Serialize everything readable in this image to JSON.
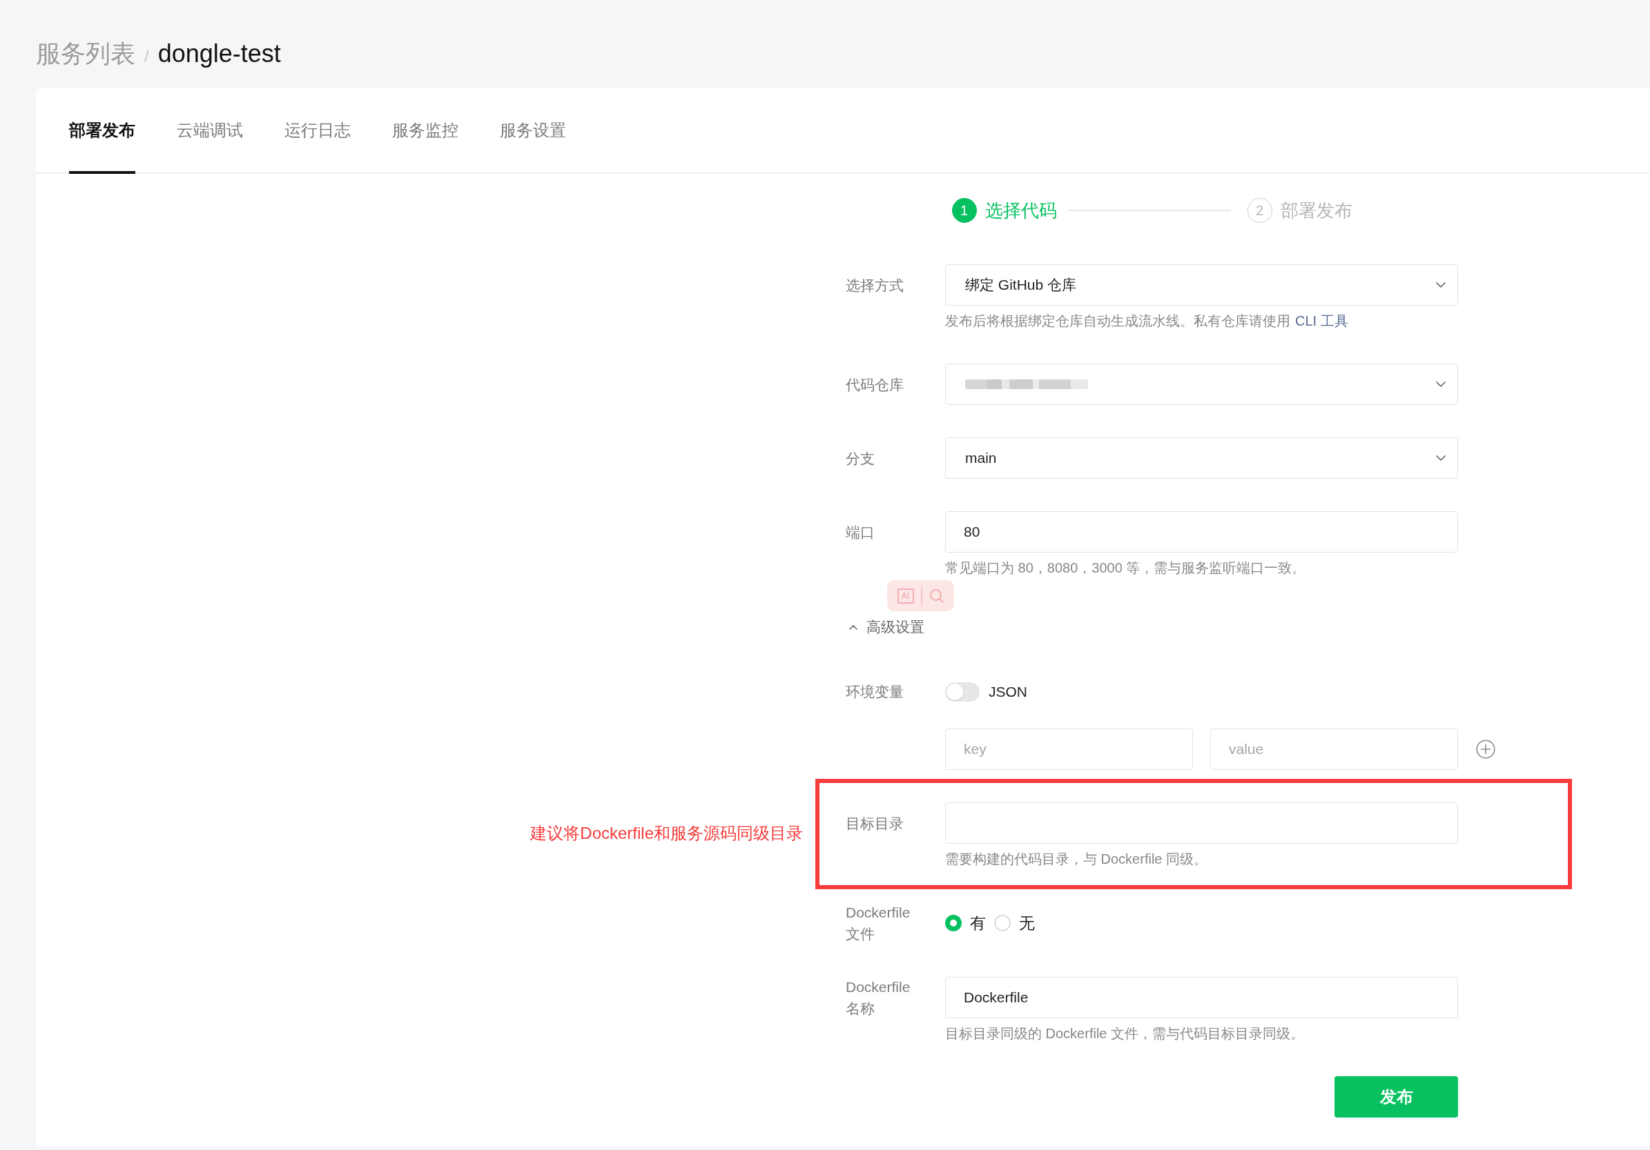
{
  "breadcrumb": {
    "parent": "服务列表",
    "separator": "/",
    "current": "dongle-test"
  },
  "tabs": [
    {
      "label": "部署发布",
      "selected": true
    },
    {
      "label": "云端调试",
      "selected": false
    },
    {
      "label": "运行日志",
      "selected": false
    },
    {
      "label": "服务监控",
      "selected": false
    },
    {
      "label": "服务设置",
      "selected": false
    }
  ],
  "steps": [
    {
      "number": "1",
      "label": "选择代码",
      "current": true
    },
    {
      "number": "2",
      "label": "部署发布",
      "current": false
    }
  ],
  "form": {
    "rows": [
      {
        "kind": "select",
        "label": "选择方式",
        "value": "绑定 GitHub 仓库",
        "help": "发布后将根据绑定仓库自动生成流水线。私有仓库请使用",
        "help_link": "CLI 工具"
      },
      {
        "kind": "select",
        "label": "代码仓库",
        "blurred": true
      },
      {
        "kind": "select",
        "label": "分支",
        "value": "main"
      },
      {
        "kind": "input",
        "label": "端口",
        "value": "80",
        "help": "常见端口为 80，8080，3000 等，需与服务监听端口一致。"
      },
      {
        "kind": "collapse",
        "label": "高级设置",
        "expanded": true
      },
      {
        "kind": "switch",
        "label": "环境变量",
        "switch_label": "JSON",
        "on": false
      },
      {
        "kind": "keyvalue",
        "key_placeholder": "key",
        "value_placeholder": "value"
      },
      {
        "kind": "input",
        "label": "目标目录",
        "help": "需要构建的代码目录，与 Dockerfile 同级。",
        "annotation": "建议将Dockerfile和服务源码同级目录"
      },
      {
        "kind": "radio",
        "label": "Dockerfile 文件",
        "options": [
          {
            "label": "有",
            "selected": true
          },
          {
            "label": "无",
            "selected": false
          }
        ]
      },
      {
        "kind": "input",
        "label": "Dockerfile 名称",
        "value": "Dockerfile",
        "help": "目标目录同级的 Dockerfile 文件，需与代码目标目录同级。"
      },
      {
        "kind": "button",
        "label": "发布"
      }
    ]
  },
  "floating_toolbar": {
    "label": "AI"
  }
}
